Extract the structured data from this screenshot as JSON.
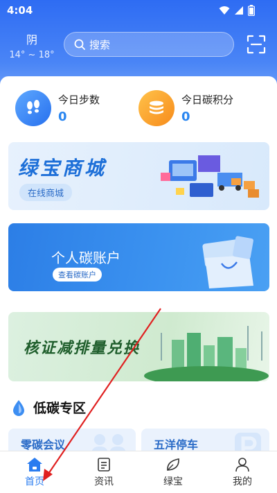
{
  "status_bar": {
    "time": "4:04"
  },
  "weather": {
    "condition": "阴",
    "temp_range": "14° ~ 18°"
  },
  "search": {
    "placeholder": "搜索"
  },
  "stats": [
    {
      "label": "今日步数",
      "value": "0",
      "icon": "footprints-icon"
    },
    {
      "label": "今日碳积分",
      "value": "0",
      "icon": "coins-icon"
    }
  ],
  "banners": {
    "mall": {
      "title": "绿宝商城",
      "button": "在线商城"
    },
    "account": {
      "title": "个人碳账户",
      "button": "查看碳账户"
    },
    "verify": {
      "title": "核证减排量兑换"
    }
  },
  "section": {
    "title": "低碳专区"
  },
  "cards": [
    {
      "label": "零碳会议"
    },
    {
      "label": "五洋停车"
    }
  ],
  "tabbar": [
    {
      "label": "首页",
      "icon": "home-icon",
      "active": true
    },
    {
      "label": "资讯",
      "icon": "news-icon",
      "active": false
    },
    {
      "label": "绿宝",
      "icon": "leaf-icon",
      "active": false
    },
    {
      "label": "我的",
      "icon": "profile-icon",
      "active": false
    }
  ],
  "colors": {
    "primary": "#2e6cf3",
    "accent_orange": "#f78b1b",
    "active_tab": "#2a7cf0",
    "annotation_arrow": "#e02020"
  }
}
